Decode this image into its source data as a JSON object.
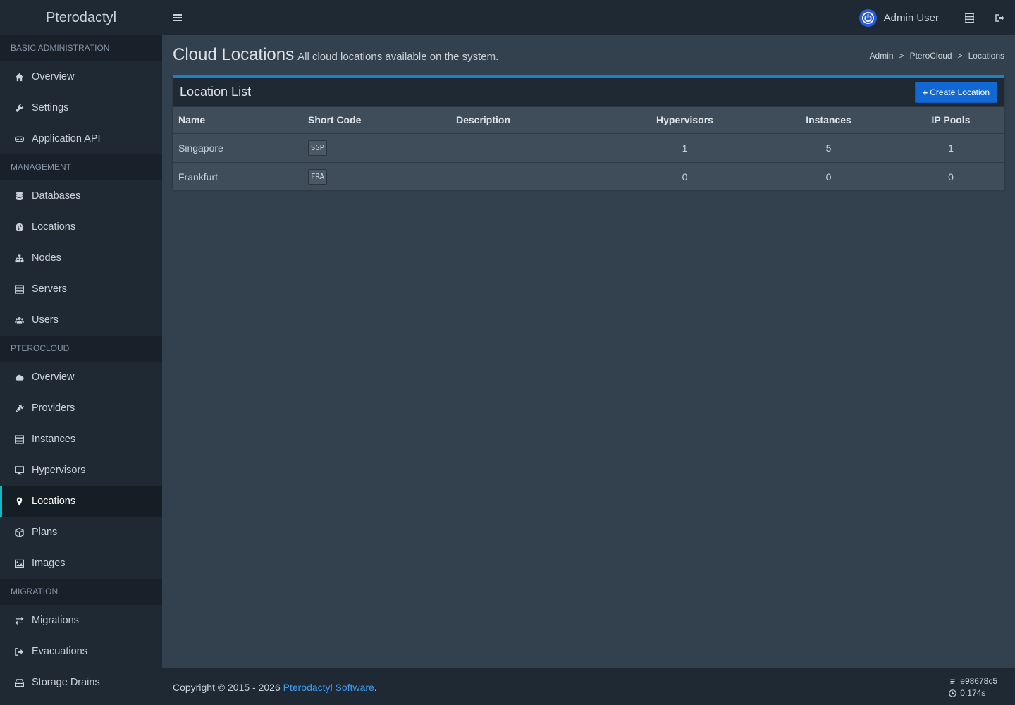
{
  "app": {
    "logo": "Pterodactyl"
  },
  "header": {
    "user_name": "Admin User",
    "icons": [
      "power-icon",
      "server-icon",
      "logout-icon"
    ]
  },
  "sidebar": {
    "sections": [
      {
        "title": "BASIC ADMINISTRATION",
        "items": [
          {
            "label": "Overview",
            "icon": "home-icon"
          },
          {
            "label": "Settings",
            "icon": "wrench-icon"
          },
          {
            "label": "Application API",
            "icon": "gamepad-icon"
          }
        ]
      },
      {
        "title": "MANAGEMENT",
        "items": [
          {
            "label": "Databases",
            "icon": "database-icon"
          },
          {
            "label": "Locations",
            "icon": "globe-icon"
          },
          {
            "label": "Nodes",
            "icon": "sitemap-icon"
          },
          {
            "label": "Servers",
            "icon": "server-icon"
          },
          {
            "label": "Users",
            "icon": "users-icon"
          }
        ]
      },
      {
        "title": "PTEROCLOUD",
        "items": [
          {
            "label": "Overview",
            "icon": "cloud-icon"
          },
          {
            "label": "Providers",
            "icon": "plug-icon"
          },
          {
            "label": "Instances",
            "icon": "server-icon"
          },
          {
            "label": "Hypervisors",
            "icon": "desktop-icon"
          },
          {
            "label": "Locations",
            "icon": "map-marker-icon",
            "active": true
          },
          {
            "label": "Plans",
            "icon": "cube-icon"
          },
          {
            "label": "Images",
            "icon": "image-icon"
          }
        ]
      },
      {
        "title": "MIGRATION",
        "items": [
          {
            "label": "Migrations",
            "icon": "exchange-icon"
          },
          {
            "label": "Evacuations",
            "icon": "sign-out-icon"
          },
          {
            "label": "Storage Drains",
            "icon": "hdd-icon"
          }
        ]
      }
    ]
  },
  "page": {
    "title": "Cloud Locations",
    "subtitle": "All cloud locations available on the system.",
    "breadcrumb": [
      "Admin",
      "PteroCloud",
      "Locations"
    ]
  },
  "box": {
    "title": "Location List",
    "create_button": "Create Location",
    "columns": [
      "Name",
      "Short Code",
      "Description",
      "Hypervisors",
      "Instances",
      "IP Pools"
    ],
    "rows": [
      {
        "name": "Singapore",
        "short_code": "SGP",
        "description": "",
        "hypervisors": "1",
        "instances": "5",
        "ip_pools": "1"
      },
      {
        "name": "Frankfurt",
        "short_code": "FRA",
        "description": "",
        "hypervisors": "0",
        "instances": "0",
        "ip_pools": "0"
      }
    ]
  },
  "footer": {
    "copyright": "Copyright © 2015 - 2026 ",
    "link": "Pterodactyl Software",
    "period": ".",
    "version": "e98678c5",
    "time": "0.174s"
  }
}
